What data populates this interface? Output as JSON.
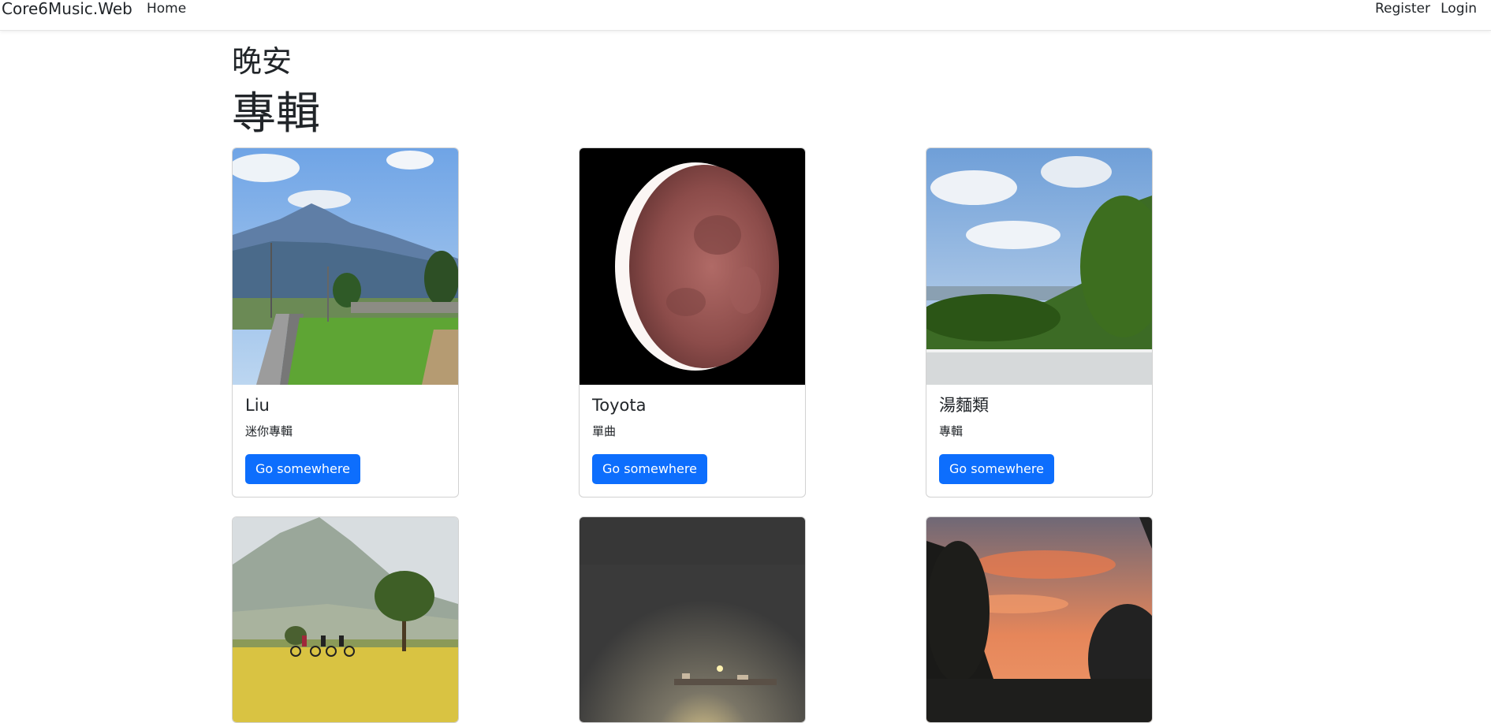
{
  "navbar": {
    "brand": "Core6Music.Web",
    "home": "Home",
    "register": "Register",
    "login": "Login"
  },
  "main": {
    "greeting": "晚安",
    "section_title": "專輯",
    "albums": [
      {
        "title": "Liu",
        "type": "迷你專輯",
        "button": "Go somewhere"
      },
      {
        "title": "Toyota",
        "type": "單曲",
        "button": "Go somewhere"
      },
      {
        "title": "湯麵類",
        "type": "專輯",
        "button": "Go somewhere"
      },
      {
        "title": "",
        "type": "",
        "button": ""
      },
      {
        "title": "",
        "type": "",
        "button": ""
      },
      {
        "title": "",
        "type": "",
        "button": ""
      }
    ]
  },
  "colors": {
    "primary_button": "#0d6efd",
    "navbar_bg": "#ffffff"
  }
}
